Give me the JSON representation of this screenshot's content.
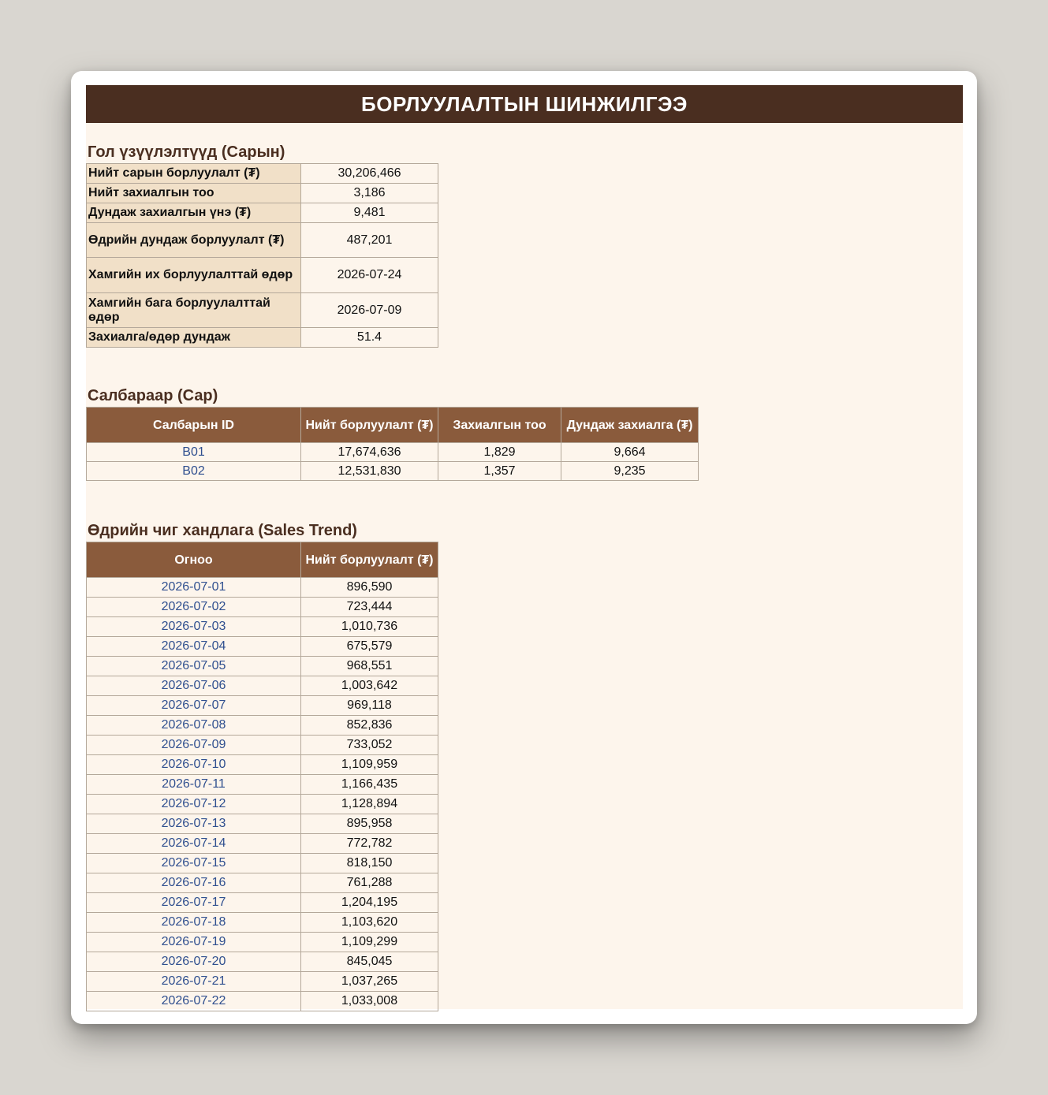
{
  "title": "БОРЛУУЛАЛТЫН ШИНЖИЛГЭЭ",
  "kpi": {
    "title": "Гол үзүүлэлтүүд (Сарын)",
    "rows": [
      {
        "label": "Нийт сарын борлуулалт (₮)",
        "value": "30,206,466"
      },
      {
        "label": "Нийт захиалгын тоо",
        "value": "3,186"
      },
      {
        "label": "Дундаж захиалгын үнэ (₮)",
        "value": "9,481"
      },
      {
        "label": "Өдрийн дундаж борлуулалт (₮)",
        "value": "487,201"
      },
      {
        "label": "Хамгийн их борлуулалттай өдөр",
        "value": "2026-07-24"
      },
      {
        "label": "Хамгийн бага борлуулалттай өдөр",
        "value": "2026-07-09"
      },
      {
        "label": "Захиалга/өдөр дундаж",
        "value": "51.4"
      }
    ]
  },
  "branches": {
    "title": "Салбараар (Сар)",
    "headers": [
      "Салбарын ID",
      "Нийт борлуулалт (₮)",
      "Захиалгын тоо",
      "Дундаж захиалга (₮)"
    ],
    "rows": [
      [
        "B01",
        "17,674,636",
        "1,829",
        "9,664"
      ],
      [
        "B02",
        "12,531,830",
        "1,357",
        "9,235"
      ]
    ]
  },
  "trend": {
    "title": "Өдрийн чиг хандлага (Sales Trend)",
    "headers": [
      "Огноо",
      "Нийт борлуулалт (₮)"
    ],
    "rows": [
      [
        "2026-07-01",
        "896,590"
      ],
      [
        "2026-07-02",
        "723,444"
      ],
      [
        "2026-07-03",
        "1,010,736"
      ],
      [
        "2026-07-04",
        "675,579"
      ],
      [
        "2026-07-05",
        "968,551"
      ],
      [
        "2026-07-06",
        "1,003,642"
      ],
      [
        "2026-07-07",
        "969,118"
      ],
      [
        "2026-07-08",
        "852,836"
      ],
      [
        "2026-07-09",
        "733,052"
      ],
      [
        "2026-07-10",
        "1,109,959"
      ],
      [
        "2026-07-11",
        "1,166,435"
      ],
      [
        "2026-07-12",
        "1,128,894"
      ],
      [
        "2026-07-13",
        "895,958"
      ],
      [
        "2026-07-14",
        "772,782"
      ],
      [
        "2026-07-15",
        "818,150"
      ],
      [
        "2026-07-16",
        "761,288"
      ],
      [
        "2026-07-17",
        "1,204,195"
      ],
      [
        "2026-07-18",
        "1,103,620"
      ],
      [
        "2026-07-19",
        "1,109,299"
      ],
      [
        "2026-07-20",
        "845,045"
      ],
      [
        "2026-07-21",
        "1,037,265"
      ],
      [
        "2026-07-22",
        "1,033,008"
      ]
    ]
  }
}
